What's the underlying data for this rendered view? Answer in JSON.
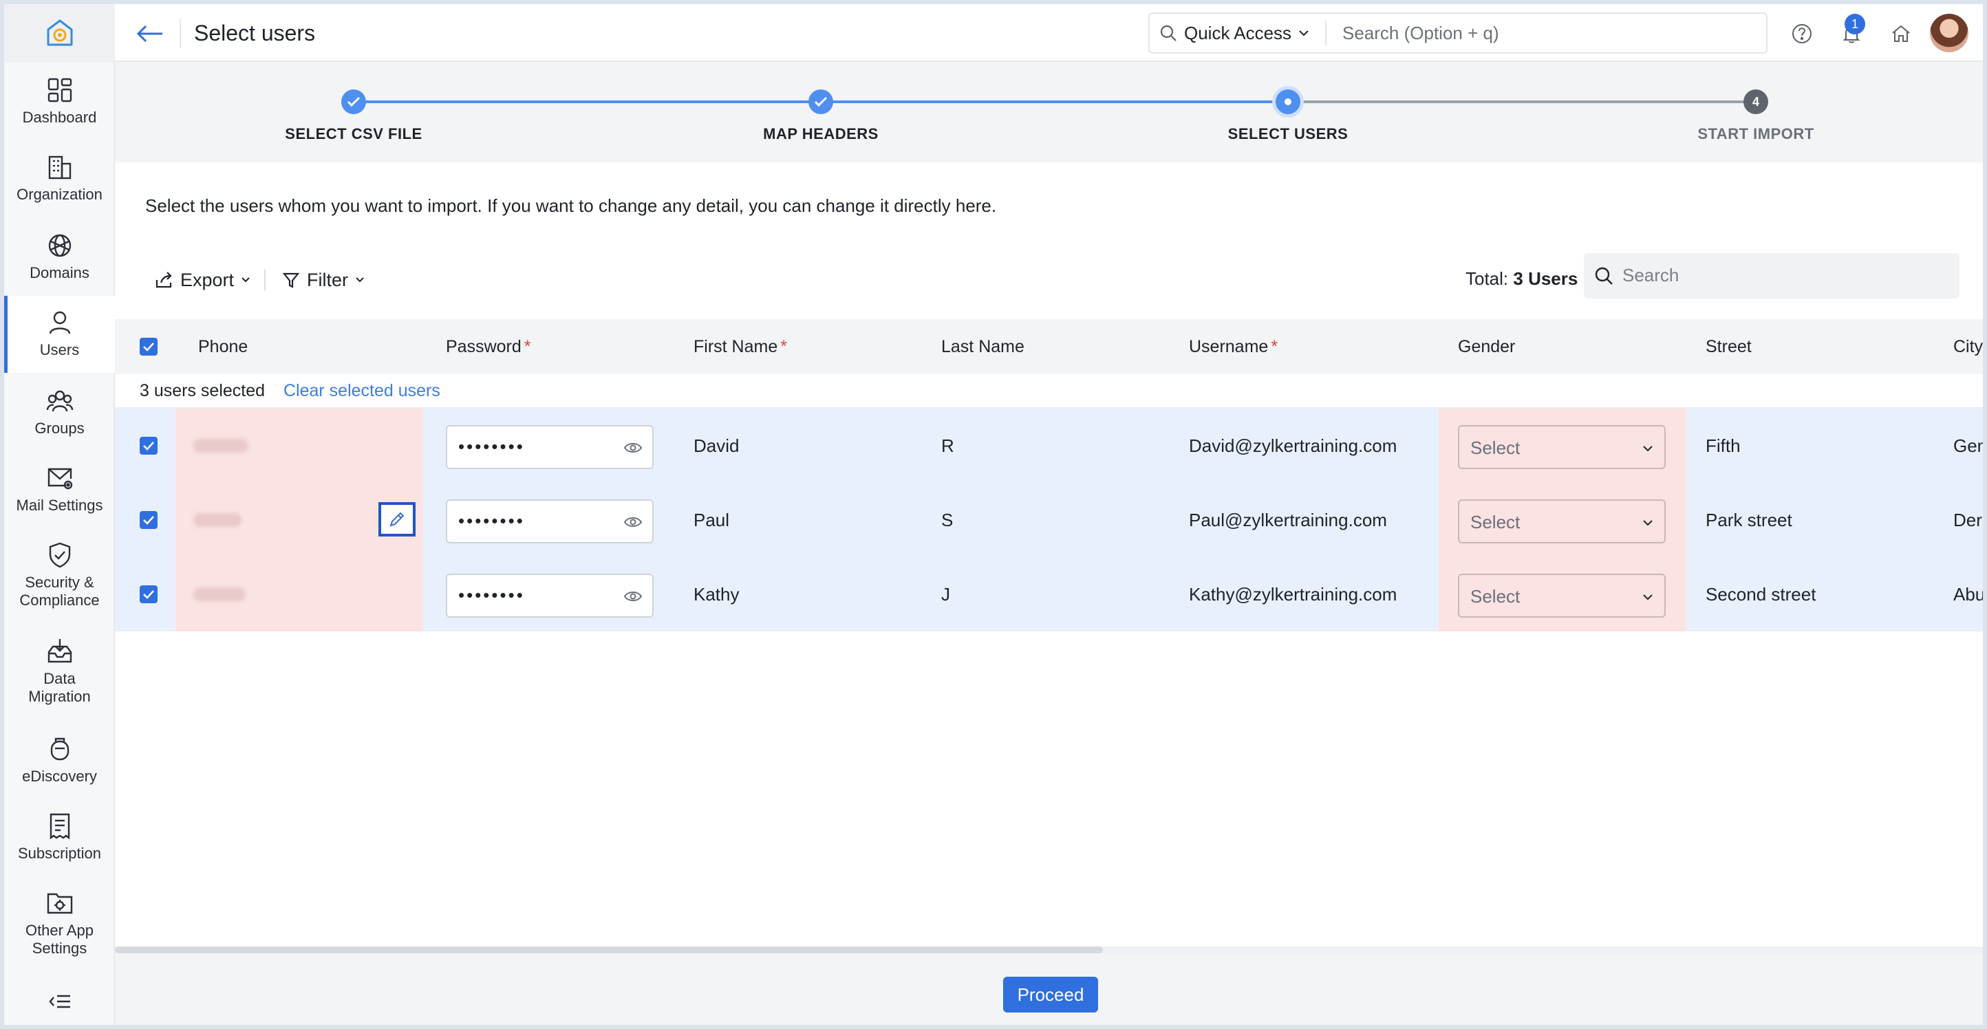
{
  "header": {
    "title": "Select users",
    "quick_access_label": "Quick Access",
    "search_placeholder": "Search (Option + q)",
    "notification_count": "1"
  },
  "sidebar": {
    "items": [
      {
        "label": "Dashboard",
        "icon": "dashboard-icon"
      },
      {
        "label": "Organization",
        "icon": "organization-icon"
      },
      {
        "label": "Domains",
        "icon": "domains-icon"
      },
      {
        "label": "Users",
        "icon": "user-icon",
        "active": true
      },
      {
        "label": "Groups",
        "icon": "groups-icon"
      },
      {
        "label": "Mail Settings",
        "icon": "mail-settings-icon"
      },
      {
        "label": "Security &\nCompliance",
        "icon": "security-icon"
      },
      {
        "label": "Data\nMigration",
        "icon": "data-migration-icon"
      },
      {
        "label": "eDiscovery",
        "icon": "ediscovery-icon"
      },
      {
        "label": "Subscription",
        "icon": "subscription-icon"
      },
      {
        "label": "Other App\nSettings",
        "icon": "other-app-settings-icon"
      }
    ]
  },
  "stepper": {
    "steps": [
      {
        "label": "SELECT CSV FILE",
        "state": "done"
      },
      {
        "label": "MAP HEADERS",
        "state": "done"
      },
      {
        "label": "SELECT USERS",
        "state": "current"
      },
      {
        "label": "START IMPORT",
        "state": "pending",
        "number": "4"
      }
    ]
  },
  "content": {
    "intro": "Select the users whom you want to import. If you want to change any detail, you can change it directly here.",
    "export_label": "Export",
    "filter_label": "Filter",
    "total_prefix": "Total:",
    "total_value": "3 Users",
    "search_placeholder": "Search",
    "selected_text": "3 users selected",
    "clear_link": "Clear selected users"
  },
  "table": {
    "columns": [
      {
        "label": "Phone",
        "required": false
      },
      {
        "label": "Password",
        "required": true
      },
      {
        "label": "First Name",
        "required": true
      },
      {
        "label": "Last Name",
        "required": false
      },
      {
        "label": "Username",
        "required": true
      },
      {
        "label": "Gender",
        "required": false
      },
      {
        "label": "Street",
        "required": false
      },
      {
        "label": "City",
        "required": false
      }
    ],
    "required_mark": "*",
    "password_mask": "••••••••",
    "gender_placeholder": "Select",
    "rows": [
      {
        "first_name": "David",
        "last_name": "R",
        "username": "David@zylkertraining.com",
        "street": "Fifth",
        "city": "Gen"
      },
      {
        "first_name": "Paul",
        "last_name": "S",
        "username": "Paul@zylkertraining.com",
        "street": "Park street",
        "city": "Derl"
      },
      {
        "first_name": "Kathy",
        "last_name": "J",
        "username": "Kathy@zylkertraining.com",
        "street": "Second street",
        "city": "Abu"
      }
    ]
  },
  "footer": {
    "proceed_label": "Proceed"
  },
  "colors": {
    "accent": "#2f6fde",
    "row_bg": "#e8f0fd",
    "error_bg": "#fbe3e3",
    "required": "#e0423b"
  }
}
